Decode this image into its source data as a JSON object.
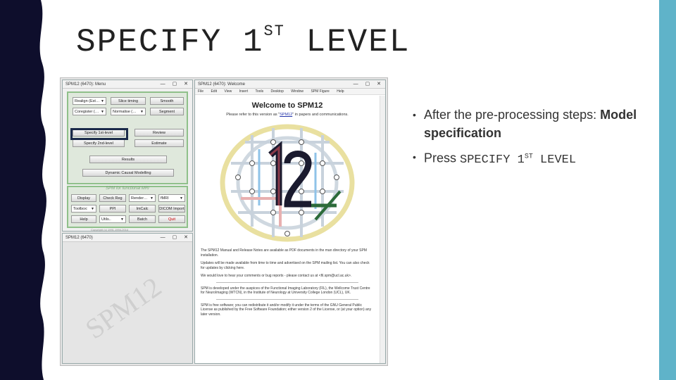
{
  "slide": {
    "title_main": "SPECIFY 1",
    "title_sup": "ST",
    "title_end": " LEVEL",
    "bullets": [
      {
        "pre": "After the pre-processing steps: ",
        "bold": "Model specification"
      },
      {
        "pre": "Press ",
        "mono": "SPECIFY 1",
        "mono_sup": "ST",
        "mono_end": " LEVEL"
      }
    ],
    "accent_color": "#5fb3c9",
    "band_color": "#0e0e2c"
  },
  "menu_window": {
    "title": "SPM12 (6470): Menu",
    "buttons": {
      "realign": "Realign (Est…",
      "slice_timing": "Slice timing",
      "smooth": "Smooth",
      "coregister": "Coregister (…",
      "normalise": "Normalise (…",
      "segment": "Segment",
      "specify_1st": "Specify 1st-level",
      "review": "Review",
      "specify_2nd": "Specify 2nd-level",
      "estimate": "Estimate",
      "results": "Results",
      "dcm": "Dynamic Causal Modelling",
      "display": "Display",
      "check_reg": "Check Reg",
      "render": "Render…",
      "modality": "fMRI",
      "toolbox": "Toolbox:",
      "pph": "PPI",
      "imcalc": "ImCalc",
      "dicom": "DICOM Import",
      "help": "Help",
      "utils": "Utils..",
      "batch": "Batch",
      "quit": "Quit"
    },
    "fmri_label": "SPM for functional MRI",
    "footer": "Copyright (c) 1991,1994-2014"
  },
  "graphics_window": {
    "title": "SPM12 (6470)",
    "watermark": "SPM12"
  },
  "welcome_window": {
    "title": "SPM12 (6470): Welcome",
    "menu": [
      "File",
      "Edit",
      "View",
      "Insert",
      "Tools",
      "Desktop",
      "Window",
      "SPM Figure",
      "Help"
    ],
    "heading": "Welcome to SPM12",
    "sub_pre": "Please refer to this version as \"",
    "sub_link": "SPM12",
    "sub_post": "\" in papers and communications.",
    "brain_label": "12",
    "p1": "The SPM12 Manual and Release Notes are available as PDF documents in the man directory of your SPM installation.",
    "p2": "Updates will be made available from time to time and advertised on the SPM mailing list. You can also check for updates by clicking here.",
    "p3": "We would love to hear your comments or bug reports - please contact us at <fil.spm@ucl.ac.uk>.",
    "p4": "SPM is developed under the auspices of the Functional Imaging Laboratory (FIL), the Wellcome Trust Centre for NeuroImaging (WTCN), in the Institute of Neurology at University College London (UCL), UK.",
    "p5": "SPM is free software; you can redistribute it and/or modify it under the terms of the GNU General Public License as published by the Free Software Foundation; either version 2 of the License, or (at your option) any later version."
  }
}
